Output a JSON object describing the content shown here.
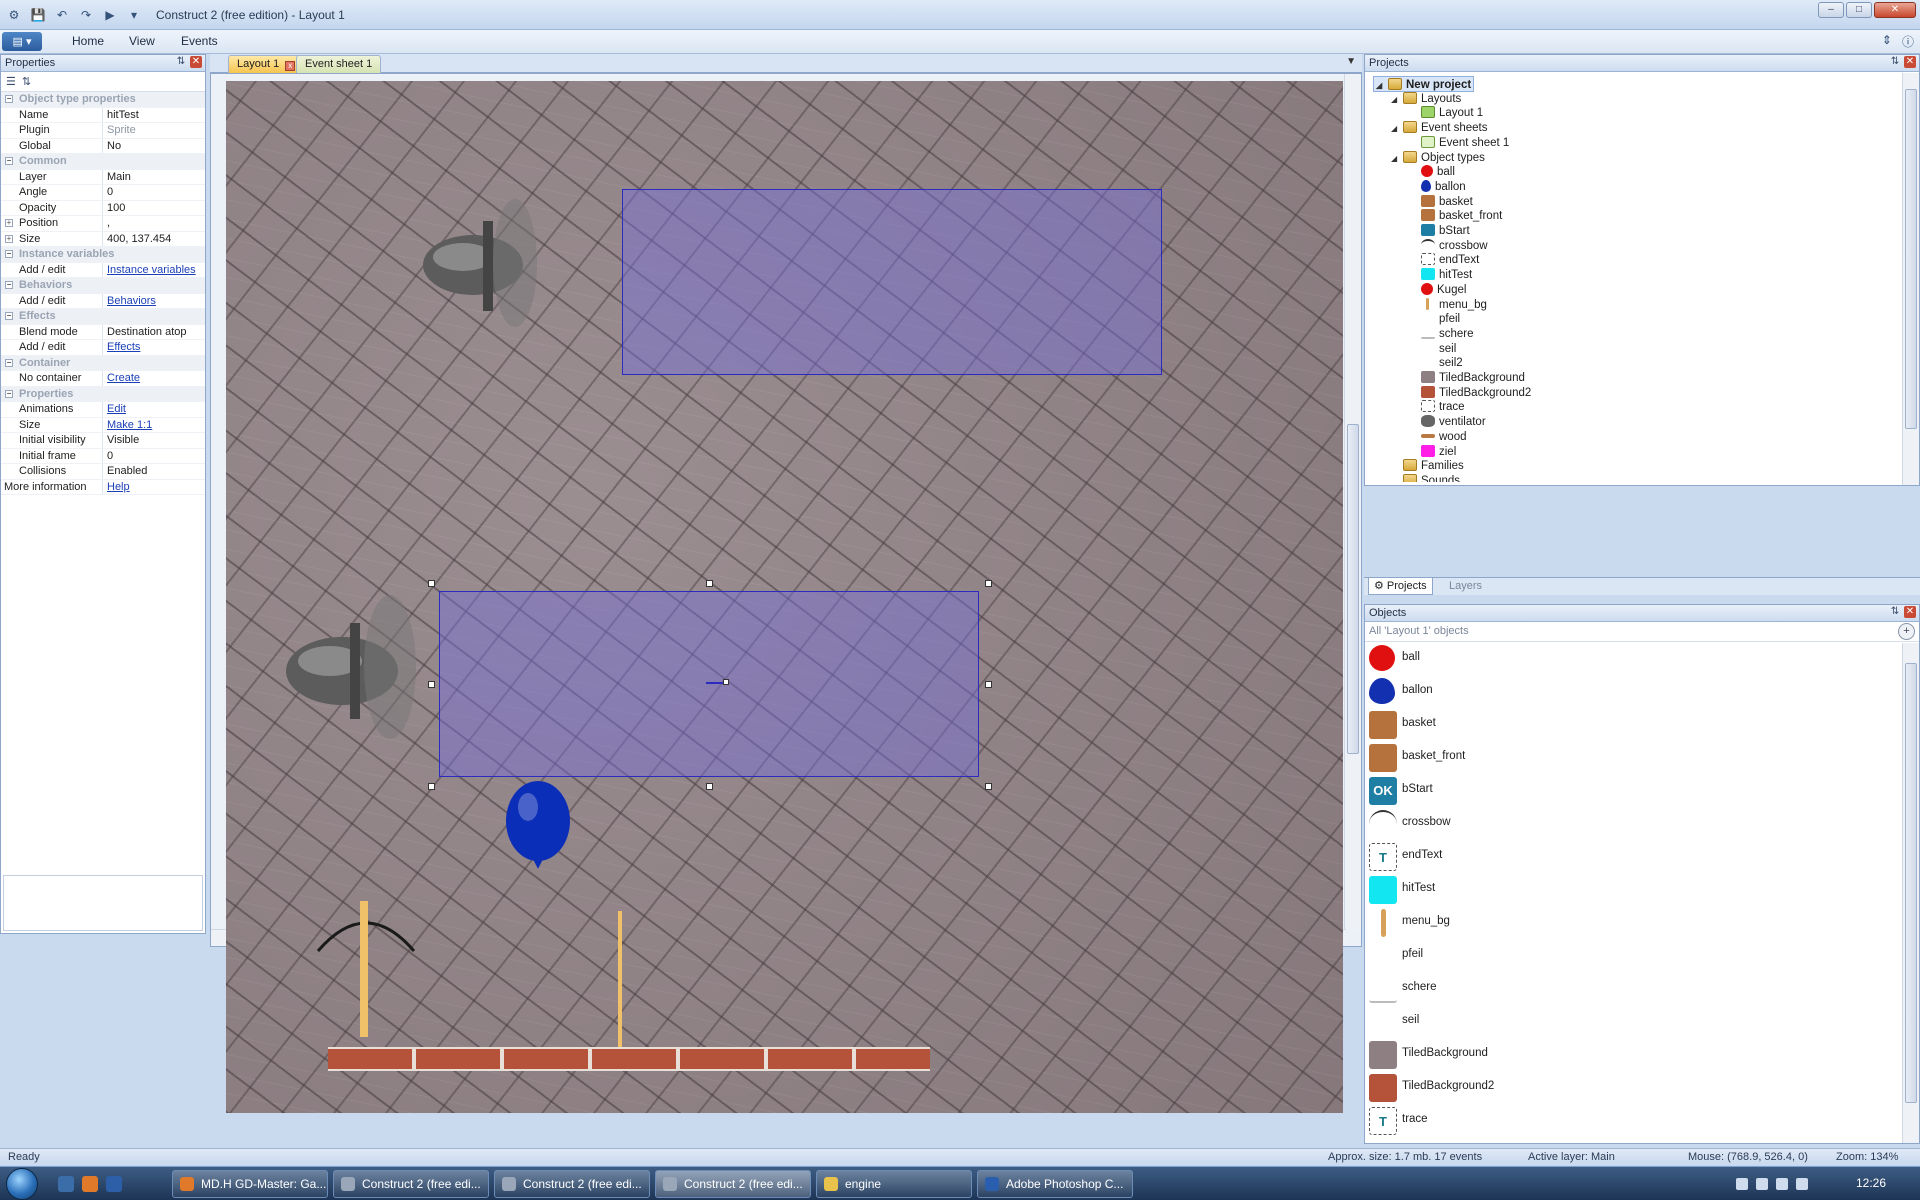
{
  "window": {
    "title": "Construct 2  (free edition) - Layout 1",
    "controls": [
      "–",
      "□",
      "✕"
    ]
  },
  "ribbon": {
    "tabs": [
      "Home",
      "View",
      "Events"
    ]
  },
  "properties": {
    "title": "Properties",
    "rows": [
      {
        "type": "cat",
        "key": "Object type properties"
      },
      {
        "type": "prop",
        "key": "Name",
        "value": "hitTest"
      },
      {
        "type": "prop",
        "key": "Plugin",
        "value": "Sprite",
        "gray": true
      },
      {
        "type": "prop",
        "key": "Global",
        "value": "No"
      },
      {
        "type": "cat",
        "key": "Common"
      },
      {
        "type": "prop",
        "key": "Layer",
        "value": "Main"
      },
      {
        "type": "prop",
        "key": "Angle",
        "value": "0"
      },
      {
        "type": "prop",
        "key": "Opacity",
        "value": "100"
      },
      {
        "type": "prop",
        "key": "Position",
        "value": ",",
        "expand": true
      },
      {
        "type": "prop",
        "key": "Size",
        "value": "400, 137.454",
        "expand": true
      },
      {
        "type": "cat",
        "key": "Instance variables"
      },
      {
        "type": "prop",
        "key": "Add / edit",
        "link": "Instance variables"
      },
      {
        "type": "cat",
        "key": "Behaviors"
      },
      {
        "type": "prop",
        "key": "Add / edit",
        "link": "Behaviors"
      },
      {
        "type": "cat",
        "key": "Effects"
      },
      {
        "type": "prop",
        "key": "Blend mode",
        "value": "Destination atop"
      },
      {
        "type": "prop",
        "key": "Add / edit",
        "link": "Effects"
      },
      {
        "type": "cat",
        "key": "Container"
      },
      {
        "type": "prop",
        "key": "No container",
        "link": "Create"
      },
      {
        "type": "cat",
        "key": "Properties"
      },
      {
        "type": "prop",
        "key": "Animations",
        "link": "Edit"
      },
      {
        "type": "prop",
        "key": "Size",
        "link": "Make 1:1"
      },
      {
        "type": "prop",
        "key": "Initial visibility",
        "value": "Visible"
      },
      {
        "type": "prop",
        "key": "Initial frame",
        "value": "0"
      },
      {
        "type": "prop",
        "key": "Collisions",
        "value": "Enabled"
      },
      {
        "type": "bare",
        "key": "More information",
        "link": "Help"
      }
    ]
  },
  "doc_tabs": [
    {
      "label": "Layout 1",
      "active": true
    },
    {
      "label": "Event sheet 1",
      "active": false
    }
  ],
  "projects": {
    "title": "Projects",
    "tree": [
      {
        "label": "New project",
        "level": 0,
        "icon": "folder",
        "bold": true,
        "selected": true,
        "expanded": true
      },
      {
        "label": "Layouts",
        "level": 1,
        "icon": "folder",
        "expanded": true
      },
      {
        "label": "Layout 1",
        "level": 2,
        "icon": "layout"
      },
      {
        "label": "Event sheets",
        "level": 1,
        "icon": "folder",
        "expanded": true
      },
      {
        "label": "Event sheet 1",
        "level": 2,
        "icon": "eventsheet"
      },
      {
        "label": "Object types",
        "level": 1,
        "icon": "folder",
        "expanded": true
      },
      {
        "label": "ball",
        "level": 2,
        "icon": "red-dot"
      },
      {
        "label": "ballon",
        "level": 2,
        "icon": "blue-balloon"
      },
      {
        "label": "basket",
        "level": 2,
        "icon": "basket"
      },
      {
        "label": "basket_front",
        "level": 2,
        "icon": "basket"
      },
      {
        "label": "bStart",
        "level": 2,
        "icon": "ok-button"
      },
      {
        "label": "crossbow",
        "level": 2,
        "icon": "crossbow"
      },
      {
        "label": "endText",
        "level": 2,
        "icon": "text"
      },
      {
        "label": "hitTest",
        "level": 2,
        "icon": "cyan-square"
      },
      {
        "label": "Kugel",
        "level": 2,
        "icon": "red-dot"
      },
      {
        "label": "menu_bg",
        "level": 2,
        "icon": "stick"
      },
      {
        "label": "pfeil",
        "level": 2,
        "icon": "none"
      },
      {
        "label": "schere",
        "level": 2,
        "icon": "scissors"
      },
      {
        "label": "seil",
        "level": 2,
        "icon": "none"
      },
      {
        "label": "seil2",
        "level": 2,
        "icon": "none"
      },
      {
        "label": "TiledBackground",
        "level": 2,
        "icon": "stone"
      },
      {
        "label": "TiledBackground2",
        "level": 2,
        "icon": "brick"
      },
      {
        "label": "trace",
        "level": 2,
        "icon": "text"
      },
      {
        "label": "ventilator",
        "level": 2,
        "icon": "fan"
      },
      {
        "label": "wood",
        "level": 2,
        "icon": "wood"
      },
      {
        "label": "ziel",
        "level": 2,
        "icon": "magenta-square"
      },
      {
        "label": "Families",
        "level": 1,
        "icon": "folder"
      },
      {
        "label": "Sounds",
        "level": 1,
        "icon": "folder"
      }
    ],
    "tabs": [
      {
        "label": "Projects",
        "active": true
      },
      {
        "label": "Layers",
        "active": false
      }
    ]
  },
  "objects": {
    "title": "Objects",
    "filter": "All 'Layout 1' objects",
    "items": [
      {
        "label": "ball",
        "icon": "red-dot"
      },
      {
        "label": "ballon",
        "icon": "blue-balloon"
      },
      {
        "label": "basket",
        "icon": "basket"
      },
      {
        "label": "basket_front",
        "icon": "basket"
      },
      {
        "label": "bStart",
        "icon": "ok-button",
        "badge": "OK"
      },
      {
        "label": "crossbow",
        "icon": "crossbow"
      },
      {
        "label": "endText",
        "icon": "text",
        "badge": "T"
      },
      {
        "label": "hitTest",
        "icon": "cyan-square"
      },
      {
        "label": "menu_bg",
        "icon": "stick"
      },
      {
        "label": "pfeil",
        "icon": "none"
      },
      {
        "label": "schere",
        "icon": "scissors"
      },
      {
        "label": "seil",
        "icon": "none"
      },
      {
        "label": "TiledBackground",
        "icon": "stone"
      },
      {
        "label": "TiledBackground2",
        "icon": "brick"
      },
      {
        "label": "trace",
        "icon": "text",
        "badge": "T"
      }
    ]
  },
  "statusbar": {
    "ready": "Ready",
    "approx": "Approx. size: 1.7 mb. 17 events",
    "layer": "Active layer: Main",
    "mouse": "Mouse: (768.9, 526.4, 0)",
    "zoom": "Zoom: 134%"
  },
  "taskbar": {
    "buttons": [
      {
        "label": "MD.H GD-Master: Ga...",
        "active": false
      },
      {
        "label": "Construct 2  (free edi...",
        "active": false
      },
      {
        "label": "Construct 2  (free edi...",
        "active": false
      },
      {
        "label": "Construct 2  (free edi...",
        "active": true
      },
      {
        "label": "engine",
        "active": false
      },
      {
        "label": "Adobe Photoshop C...",
        "active": false
      }
    ],
    "clock": "12:26"
  },
  "colors": {
    "ribbon_bg": "#dbe6f4",
    "active_tab": "#f6c451",
    "link": "#1a3fb7",
    "hitbox": "#2b2bbf"
  }
}
